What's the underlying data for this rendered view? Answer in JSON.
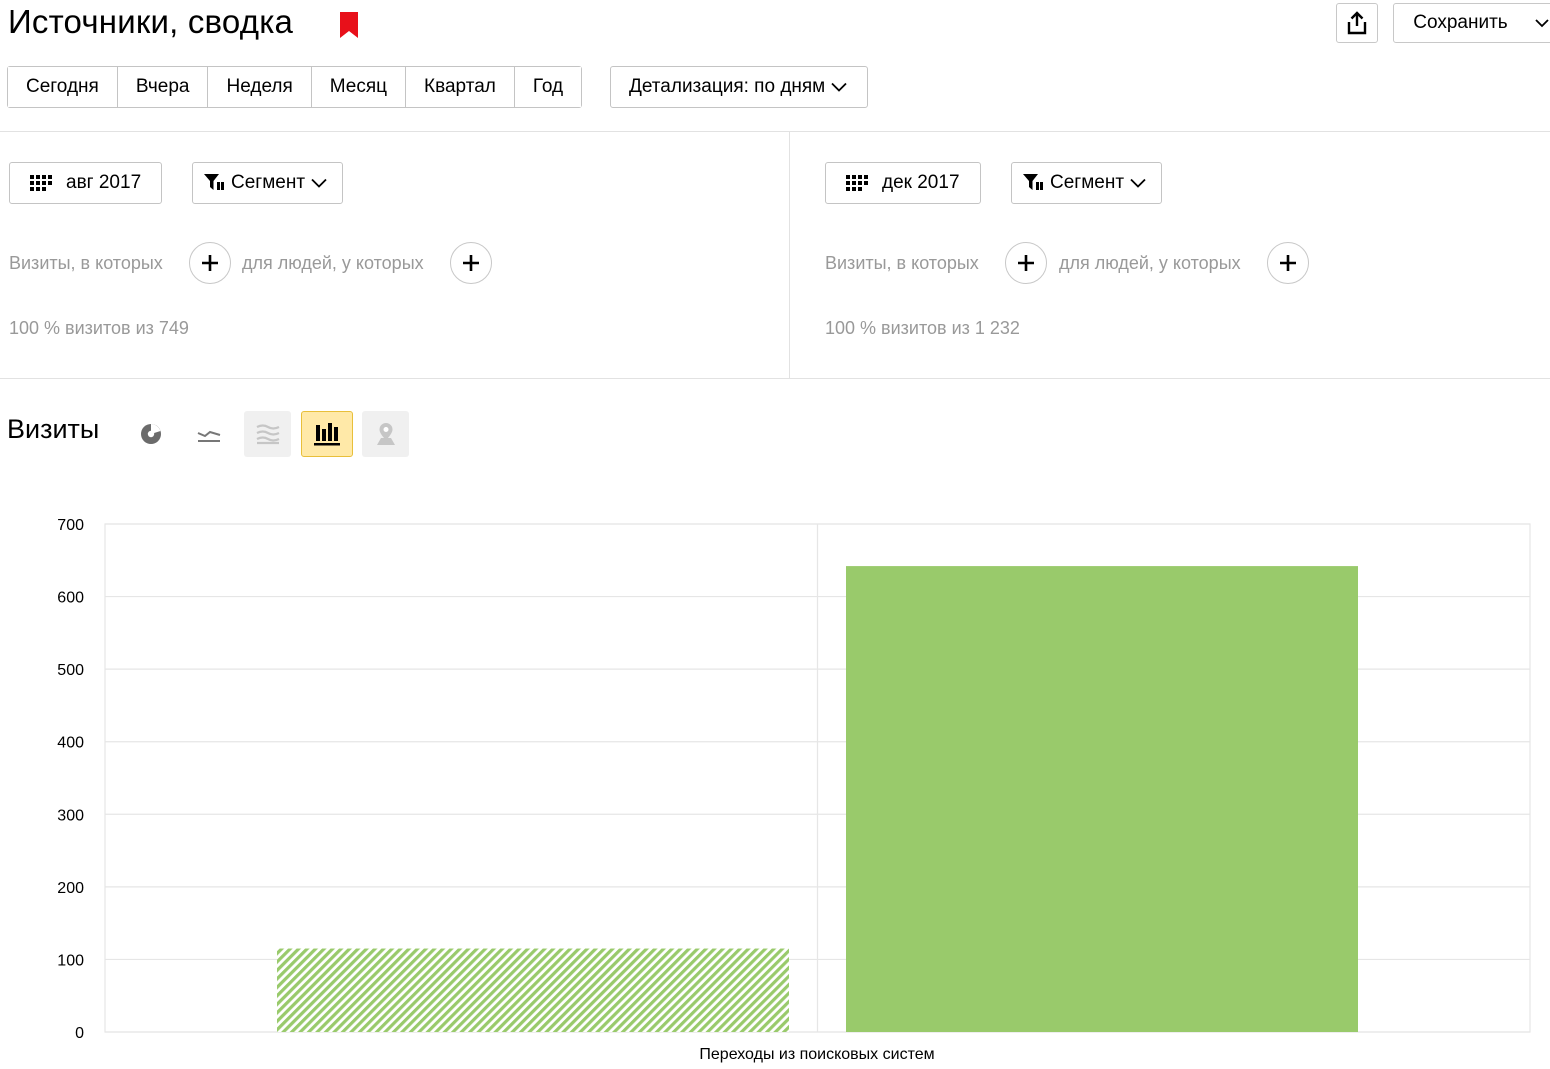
{
  "header": {
    "title": "Источники, сводка",
    "save_label": "Сохранить"
  },
  "periods": [
    "Сегодня",
    "Вчера",
    "Неделя",
    "Месяц",
    "Квартал",
    "Год"
  ],
  "detail": {
    "label": "Детализация: по дням"
  },
  "segments": [
    {
      "date_label": "авг 2017",
      "segment_label": "Сегмент",
      "visits_text": "Визиты, в которых",
      "people_text": "для людей, у которых",
      "summary": "100 % визитов из 749"
    },
    {
      "date_label": "дек 2017",
      "segment_label": "Сегмент",
      "visits_text": "Визиты, в которых",
      "people_text": "для людей, у которых",
      "summary": "100 % визитов из 1 232"
    }
  ],
  "visits": {
    "title": "Визиты",
    "chart_types": [
      {
        "icon": "pie-chart-icon",
        "active": false,
        "disabled": false
      },
      {
        "icon": "line-chart-icon",
        "active": false,
        "disabled": false
      },
      {
        "icon": "area-chart-icon",
        "active": false,
        "disabled": true
      },
      {
        "icon": "bar-chart-icon",
        "active": true,
        "disabled": false
      },
      {
        "icon": "map-pin-icon",
        "active": false,
        "disabled": true
      }
    ]
  },
  "colors": {
    "bookmark": "#e8101a",
    "bar": "#99ca6b",
    "bar_hatch_bg": "#ffffff",
    "active_tab_bg": "#ffe9a8",
    "active_tab_border": "#e8bf3a",
    "grid": "#e6e6e6"
  },
  "chart_data": {
    "type": "bar",
    "categories": [
      "Переходы из поисковых систем"
    ],
    "series": [
      {
        "values": [
          115
        ],
        "style": "hatched"
      },
      {
        "values": [
          642
        ],
        "style": "solid"
      }
    ],
    "ylim": [
      0,
      700
    ],
    "yticks": [
      0,
      100,
      200,
      300,
      400,
      500,
      600,
      700
    ],
    "grid": true
  }
}
